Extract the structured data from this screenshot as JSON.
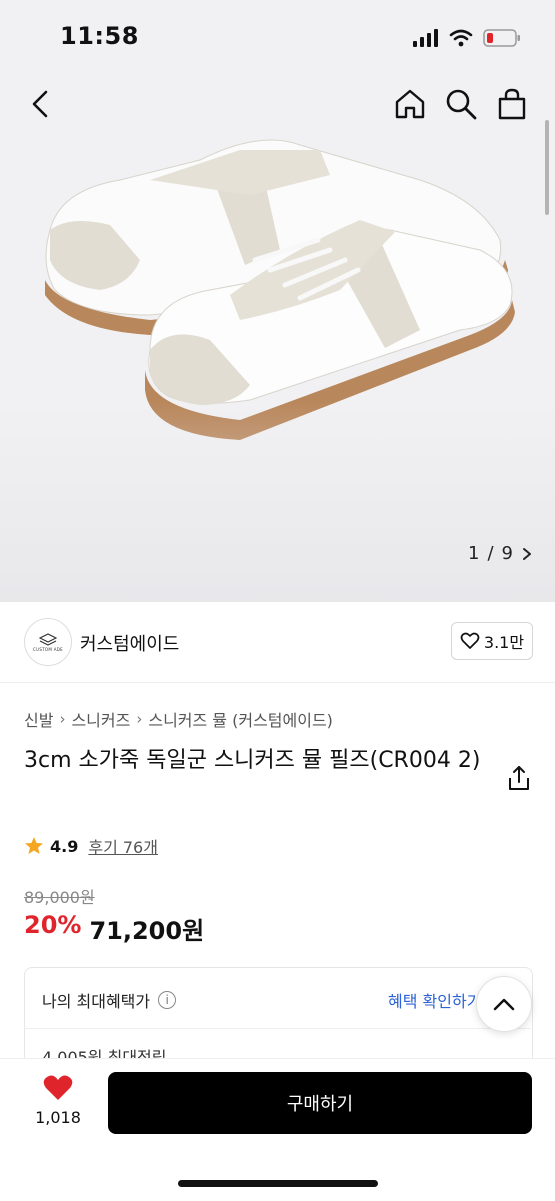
{
  "status_bar": {
    "time": "11:58"
  },
  "gallery": {
    "current": "1",
    "separator": "/",
    "total": "9"
  },
  "store": {
    "name": "커스텀에이드",
    "logo_text": "CUSTOM ADE",
    "likes": "3.1만"
  },
  "breadcrumb": [
    "신발",
    "스니커즈",
    "스니커즈 뮬 (커스텀에이드)"
  ],
  "product": {
    "title": "3cm 소가죽 독일군 스니커즈 뮬 필즈(CR004 2)",
    "rating": "4.9",
    "reviews": "후기 76개",
    "original_price": "89,000원",
    "discount": "20%",
    "price": "71,200원"
  },
  "benefit": {
    "label": "나의 최대혜택가",
    "link": "혜택 확인하기",
    "sub": "4,005원 최대적립"
  },
  "bottom_bar": {
    "wish_count": "1,018",
    "buy_label": "구매하기"
  },
  "colors": {
    "accent_red": "#e0242b",
    "link_blue": "#2c63d6",
    "buy_button": "#000000",
    "heart": "#e0242b"
  }
}
